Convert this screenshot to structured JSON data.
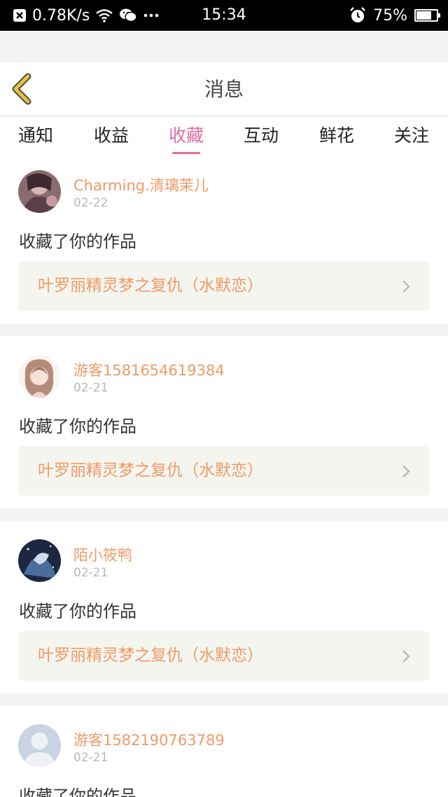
{
  "status_bar": {
    "speed": "0.78K/s",
    "time": "15:34",
    "battery": "75%",
    "battery_level": 0.75,
    "icons": [
      "close-box-icon",
      "wifi-icon",
      "wechat-icon",
      "more-dots-icon",
      "alarm-icon",
      "battery-icon"
    ]
  },
  "header": {
    "title": "消息",
    "back_icon": "chevron-left-icon"
  },
  "tabs": [
    {
      "label": "通知",
      "active": false
    },
    {
      "label": "收益",
      "active": false
    },
    {
      "label": "收藏",
      "active": true
    },
    {
      "label": "互动",
      "active": false
    },
    {
      "label": "鲜花",
      "active": false
    },
    {
      "label": "关注",
      "active": false
    }
  ],
  "messages": [
    {
      "user": "Charming.清璃茉儿",
      "date": "02-22",
      "action": "收藏了你的作品",
      "work": "叶罗丽精灵梦之复仇（水默恋）",
      "avatar": "user-avatar-icon"
    },
    {
      "user": "游客1581654619384",
      "date": "02-21",
      "action": "收藏了你的作品",
      "work": "叶罗丽精灵梦之复仇（水默恋）",
      "avatar": "user-avatar-icon"
    },
    {
      "user": "陌小筱鸭",
      "date": "02-21",
      "action": "收藏了你的作品",
      "work": "叶罗丽精灵梦之复仇（水默恋）",
      "avatar": "user-avatar-icon"
    },
    {
      "user": "游客1582190763789",
      "date": "02-21",
      "action": "收藏了你的作品",
      "work": "",
      "avatar": "default-avatar-icon"
    }
  ],
  "colors": {
    "accent": "#e06ba3",
    "username": "#ef9a66",
    "back_chevron": "#e8c23a"
  }
}
